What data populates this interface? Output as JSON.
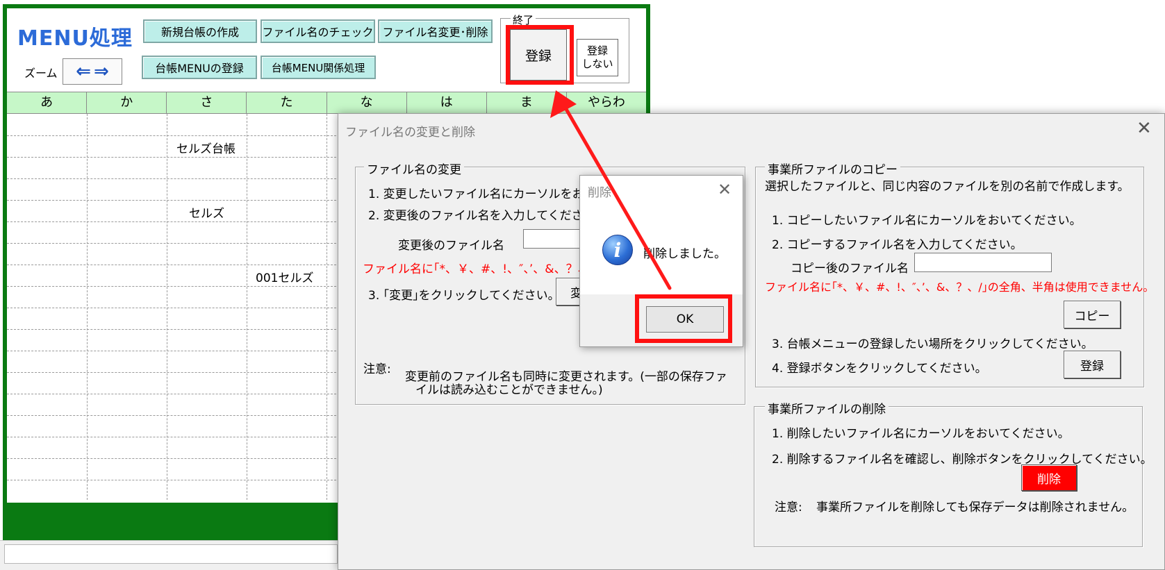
{
  "sheet": {
    "title": "MENU処理",
    "toolbar_buttons": [
      "新規台帳の作成",
      "ファイル名のチェック",
      "ファイル名変更･削除",
      "台帳MENUの登録",
      "台帳MENU関係処理"
    ],
    "zoom_label": "ズーム",
    "zoom_left_icon": "left-arrow-icon",
    "zoom_right_icon": "right-arrow-icon",
    "end_group_legend": "終了",
    "register_button": "登録",
    "no_register_line1": "登録",
    "no_register_line2": "しない",
    "kana_tabs": [
      "あ",
      "か",
      "さ",
      "た",
      "な",
      "は",
      "ま",
      "やらわ"
    ],
    "cells": {
      "sa_row2": "セルズ台帳",
      "sa_row5": "セルズ",
      "ta_row8": "001セルズ"
    }
  },
  "dialog": {
    "title": "ファイル名の変更と削除",
    "rename": {
      "legend": "ファイル名の変更",
      "step1": "1. 変更したいファイル名にカーソルをおいて",
      "step2": "2. 変更後のファイル名を入力してください。",
      "field_label": "変更後のファイル名",
      "field_value": "",
      "warning": "ファイル名に｢*、￥、#、!、″、’、&、？、/｣の",
      "step3": "3. ｢変更｣をクリックしてください。",
      "change_button": "変",
      "note_label": "注意:",
      "note_line1": "変更前のファイル名も同時に変更されます。(一部の保存ファ",
      "note_line2": "イルは読み込むことができません。)"
    },
    "copy": {
      "legend": "事業所ファイルのコピー",
      "desc": "選択したファイルと、同じ内容のファイルを別の名前で作成します。",
      "step1": "1. コピーしたいファイル名にカーソルをおいてください。",
      "step2": "2. コピーするファイル名を入力してください。",
      "field_label": "コピー後のファイル名",
      "field_value": "",
      "warning": "ファイル名に｢*、￥、#、!、″、’、&、？、/｣の全角、半角は使用できません。",
      "copy_button": "コピー",
      "step3": "3. 台帳メニューの登録したい場所をクリックしてください。",
      "step4": "4. 登録ボタンをクリックしてください。",
      "register_button": "登録"
    },
    "delete": {
      "legend": "事業所ファイルの削除",
      "step1": "1. 削除したいファイル名にカーソルをおいてください。",
      "step2": "2. 削除するファイル名を確認し、削除ボタンをクリックしてください。",
      "delete_button": "削除",
      "note_label": "注意:",
      "note_text": "事業所ファイルを削除しても保存データは削除されません。"
    }
  },
  "message_box": {
    "title": "削除",
    "icon": "info-icon",
    "text": "削除しました。",
    "ok_button": "OK"
  },
  "colors": {
    "sheet_green": "#0a7a12",
    "header_green": "#c6f7c8",
    "toolbar_button": "#bdeee9",
    "title_blue": "#2c6bd8",
    "highlight_red": "#ff1010",
    "delete_button_red": "#ff0000"
  }
}
